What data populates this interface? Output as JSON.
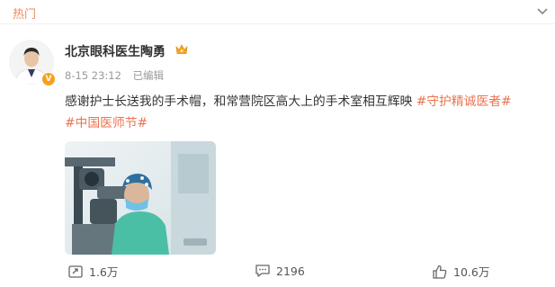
{
  "header": {
    "label": "热门",
    "chevron_icon": "chevron-down-icon"
  },
  "post": {
    "author": "北京眼科医生陶勇",
    "verified_badge": "V",
    "author_badge_icon": "crown-icon",
    "time": "8-15 23:12",
    "edited_label": "已编辑",
    "text": "感谢护士长送我的手术帽，和常营院区高大上的手术室相互辉映",
    "tags": [
      "#守护精诚医者#",
      "#中国医师节#"
    ],
    "image_icon": "surgery-photo"
  },
  "actions": {
    "repost": {
      "icon": "repost-icon",
      "count": "1.6万"
    },
    "comment": {
      "icon": "comment-icon",
      "count": "2196"
    },
    "like": {
      "icon": "like-icon",
      "count": "10.6万"
    }
  },
  "colors": {
    "accent": "#eb7350",
    "header": "#f08a5d",
    "badge": "#f7a01a"
  }
}
